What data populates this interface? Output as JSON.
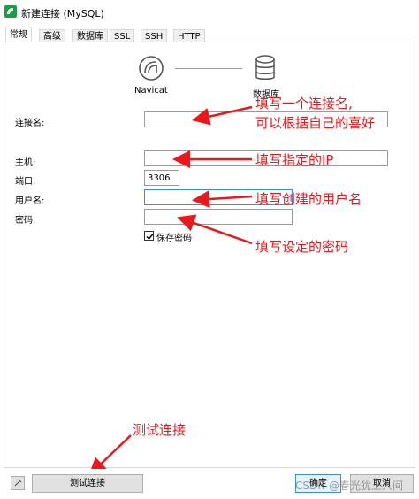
{
  "window": {
    "title": "新建连接 (MySQL)"
  },
  "tabs": [
    {
      "label": "常规"
    },
    {
      "label": "高级"
    },
    {
      "label": "数据库"
    },
    {
      "label": "SSL"
    },
    {
      "label": "SSH"
    },
    {
      "label": "HTTP"
    }
  ],
  "graphic": {
    "navicat_label": "Navicat",
    "db_label": "数据库"
  },
  "form": {
    "conn_name_label": "连接名:",
    "conn_name_value": "",
    "host_label": "主机:",
    "host_value": "",
    "port_label": "端口:",
    "port_value": "3306",
    "user_label": "用户名:",
    "user_value": "",
    "password_label": "密码:",
    "password_value": "",
    "save_password_label": "保存密码",
    "save_password_checked": true
  },
  "annotations": {
    "conn_name_line1": "填写一个连接名,",
    "conn_name_line2": "可以根据自己的喜好",
    "host": "填写指定的IP",
    "user": "填写创建的用户名",
    "password": "填写设定的密码",
    "test": "测试连接"
  },
  "buttons": {
    "test_connection": "测试连接",
    "ok": "确定",
    "cancel": "取消"
  },
  "watermark": "CSDN @春光犹上人间",
  "colors": {
    "annotation": "#e8181c",
    "app_icon": "#1a9e3f",
    "focus_border": "#3c8cde"
  }
}
